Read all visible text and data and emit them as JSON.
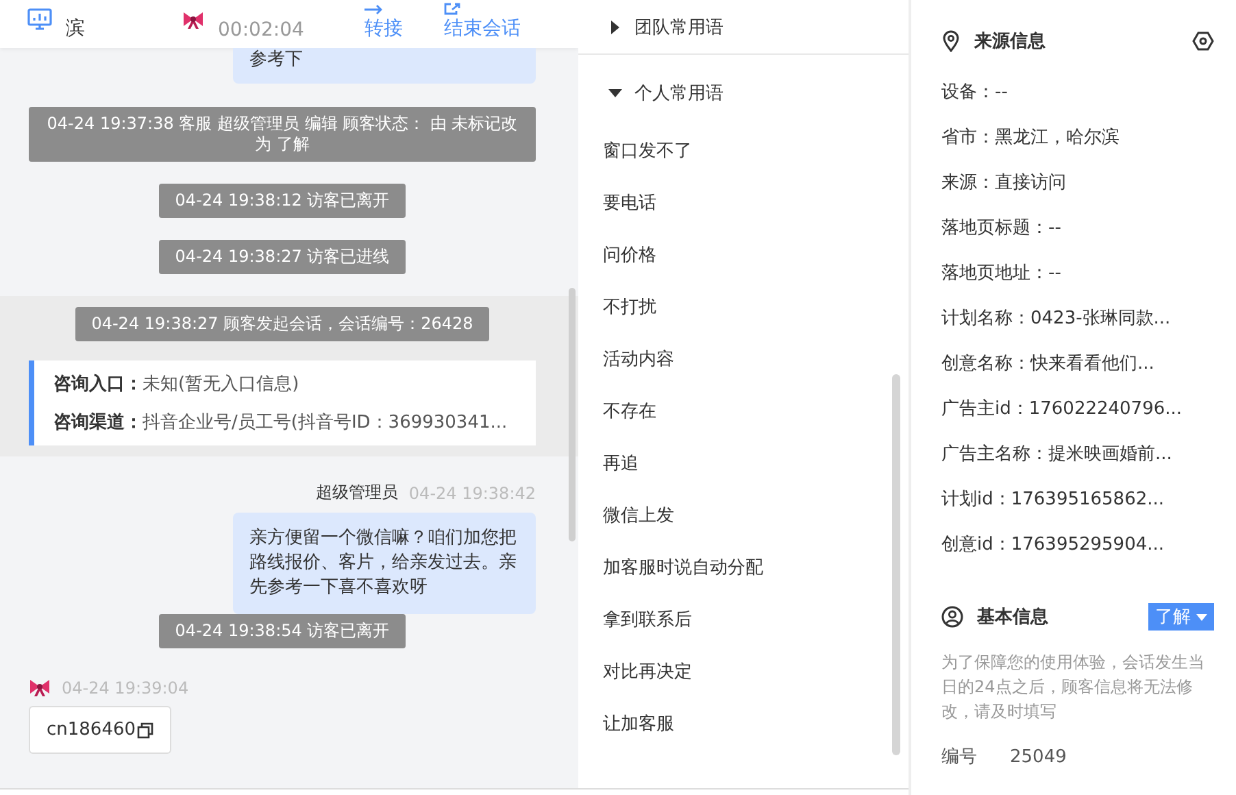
{
  "header": {
    "location": "滨",
    "session_time": "00:02:04",
    "actions": [
      {
        "kind": "transfer",
        "label": "转接"
      },
      {
        "kind": "end",
        "label": "结束会话"
      }
    ]
  },
  "chat": {
    "messages": [
      {
        "kind": "bubble",
        "text": "参考下"
      },
      {
        "kind": "system",
        "text": "04-24 19:37:38 客服 超级管理员 编辑 顾客状态： 由 未标记改为 了解"
      },
      {
        "kind": "system",
        "text": "04-24 19:38:12 访客已离开"
      },
      {
        "kind": "system",
        "text": "04-24 19:38:27 访客已进线"
      },
      {
        "kind": "session",
        "notice": "04-24 19:38:27 顾客发起会话，会话编号：26428",
        "fields": [
          {
            "label": "咨询入口：",
            "value": "未知(暂无入口信息)"
          },
          {
            "label": "咨询渠道：",
            "value": "抖音企业号/员工号(抖音号ID：369930341..."
          }
        ]
      },
      {
        "kind": "bubble",
        "sender": "超级管理员",
        "time": "04-24 19:38:42",
        "text": "亲方便留一个微信嘛？咱们加您把路线报价、客片，给亲发过去。亲先参考一下喜不喜欢呀"
      },
      {
        "kind": "system",
        "text": "04-24 19:38:54 访客已离开"
      },
      {
        "kind": "visitor",
        "time": "04-24 19:39:04",
        "text": "cn186460"
      }
    ]
  },
  "phrases": {
    "groups": [
      {
        "title": "团队常用语",
        "expanded": false
      },
      {
        "title": "个人常用语",
        "expanded": true,
        "items": [
          "窗口发不了",
          "要电话",
          "问价格",
          "不打扰",
          "活动内容",
          "不存在",
          "再追",
          "微信上发",
          "加客服时说自动分配",
          "拿到联系后",
          "对比再决定",
          "让加客服"
        ]
      }
    ]
  },
  "source_info": {
    "title": "来源信息",
    "fields": [
      "设备：--",
      "省市：黑龙江，哈尔滨",
      "来源：直接访问",
      "落地页标题：--",
      "落地页地址：--",
      "计划名称：0423-张琳同款...",
      "创意名称：快来看看他们...",
      "广告主id：176022240796...",
      "广告主名称：提米映画婚前...",
      "计划id：176395165862...",
      "创意id：176395295904..."
    ]
  },
  "basic_info": {
    "title": "基本信息",
    "status_button": "了解",
    "note": "为了保障您的使用体验，会话发生当日的24点之后，顾客信息将无法修改，请及时填写",
    "fields": [
      {
        "label": "编号",
        "value": "25049"
      }
    ]
  }
}
